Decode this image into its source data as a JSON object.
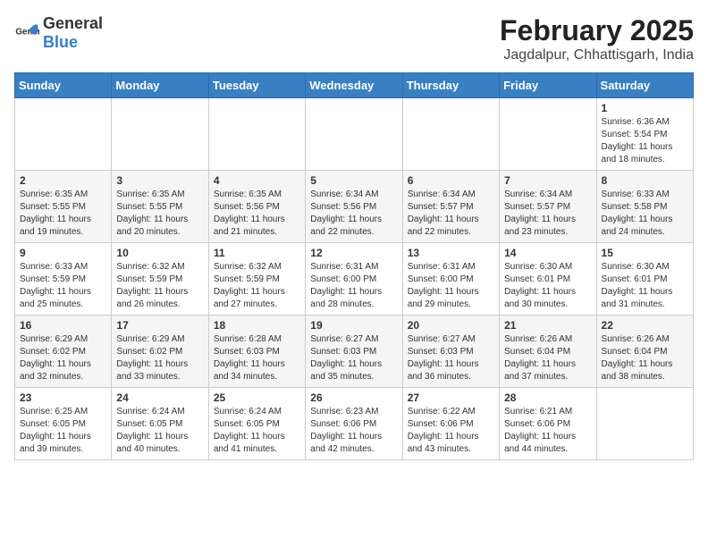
{
  "header": {
    "logo_general": "General",
    "logo_blue": "Blue",
    "month": "February 2025",
    "location": "Jagdalpur, Chhattisgarh, India"
  },
  "weekdays": [
    "Sunday",
    "Monday",
    "Tuesday",
    "Wednesday",
    "Thursday",
    "Friday",
    "Saturday"
  ],
  "weeks": [
    [
      {
        "day": "",
        "info": ""
      },
      {
        "day": "",
        "info": ""
      },
      {
        "day": "",
        "info": ""
      },
      {
        "day": "",
        "info": ""
      },
      {
        "day": "",
        "info": ""
      },
      {
        "day": "",
        "info": ""
      },
      {
        "day": "1",
        "info": "Sunrise: 6:36 AM\nSunset: 5:54 PM\nDaylight: 11 hours\nand 18 minutes."
      }
    ],
    [
      {
        "day": "2",
        "info": "Sunrise: 6:35 AM\nSunset: 5:55 PM\nDaylight: 11 hours\nand 19 minutes."
      },
      {
        "day": "3",
        "info": "Sunrise: 6:35 AM\nSunset: 5:55 PM\nDaylight: 11 hours\nand 20 minutes."
      },
      {
        "day": "4",
        "info": "Sunrise: 6:35 AM\nSunset: 5:56 PM\nDaylight: 11 hours\nand 21 minutes."
      },
      {
        "day": "5",
        "info": "Sunrise: 6:34 AM\nSunset: 5:56 PM\nDaylight: 11 hours\nand 22 minutes."
      },
      {
        "day": "6",
        "info": "Sunrise: 6:34 AM\nSunset: 5:57 PM\nDaylight: 11 hours\nand 22 minutes."
      },
      {
        "day": "7",
        "info": "Sunrise: 6:34 AM\nSunset: 5:57 PM\nDaylight: 11 hours\nand 23 minutes."
      },
      {
        "day": "8",
        "info": "Sunrise: 6:33 AM\nSunset: 5:58 PM\nDaylight: 11 hours\nand 24 minutes."
      }
    ],
    [
      {
        "day": "9",
        "info": "Sunrise: 6:33 AM\nSunset: 5:59 PM\nDaylight: 11 hours\nand 25 minutes."
      },
      {
        "day": "10",
        "info": "Sunrise: 6:32 AM\nSunset: 5:59 PM\nDaylight: 11 hours\nand 26 minutes."
      },
      {
        "day": "11",
        "info": "Sunrise: 6:32 AM\nSunset: 5:59 PM\nDaylight: 11 hours\nand 27 minutes."
      },
      {
        "day": "12",
        "info": "Sunrise: 6:31 AM\nSunset: 6:00 PM\nDaylight: 11 hours\nand 28 minutes."
      },
      {
        "day": "13",
        "info": "Sunrise: 6:31 AM\nSunset: 6:00 PM\nDaylight: 11 hours\nand 29 minutes."
      },
      {
        "day": "14",
        "info": "Sunrise: 6:30 AM\nSunset: 6:01 PM\nDaylight: 11 hours\nand 30 minutes."
      },
      {
        "day": "15",
        "info": "Sunrise: 6:30 AM\nSunset: 6:01 PM\nDaylight: 11 hours\nand 31 minutes."
      }
    ],
    [
      {
        "day": "16",
        "info": "Sunrise: 6:29 AM\nSunset: 6:02 PM\nDaylight: 11 hours\nand 32 minutes."
      },
      {
        "day": "17",
        "info": "Sunrise: 6:29 AM\nSunset: 6:02 PM\nDaylight: 11 hours\nand 33 minutes."
      },
      {
        "day": "18",
        "info": "Sunrise: 6:28 AM\nSunset: 6:03 PM\nDaylight: 11 hours\nand 34 minutes."
      },
      {
        "day": "19",
        "info": "Sunrise: 6:27 AM\nSunset: 6:03 PM\nDaylight: 11 hours\nand 35 minutes."
      },
      {
        "day": "20",
        "info": "Sunrise: 6:27 AM\nSunset: 6:03 PM\nDaylight: 11 hours\nand 36 minutes."
      },
      {
        "day": "21",
        "info": "Sunrise: 6:26 AM\nSunset: 6:04 PM\nDaylight: 11 hours\nand 37 minutes."
      },
      {
        "day": "22",
        "info": "Sunrise: 6:26 AM\nSunset: 6:04 PM\nDaylight: 11 hours\nand 38 minutes."
      }
    ],
    [
      {
        "day": "23",
        "info": "Sunrise: 6:25 AM\nSunset: 6:05 PM\nDaylight: 11 hours\nand 39 minutes."
      },
      {
        "day": "24",
        "info": "Sunrise: 6:24 AM\nSunset: 6:05 PM\nDaylight: 11 hours\nand 40 minutes."
      },
      {
        "day": "25",
        "info": "Sunrise: 6:24 AM\nSunset: 6:05 PM\nDaylight: 11 hours\nand 41 minutes."
      },
      {
        "day": "26",
        "info": "Sunrise: 6:23 AM\nSunset: 6:06 PM\nDaylight: 11 hours\nand 42 minutes."
      },
      {
        "day": "27",
        "info": "Sunrise: 6:22 AM\nSunset: 6:06 PM\nDaylight: 11 hours\nand 43 minutes."
      },
      {
        "day": "28",
        "info": "Sunrise: 6:21 AM\nSunset: 6:06 PM\nDaylight: 11 hours\nand 44 minutes."
      },
      {
        "day": "",
        "info": ""
      }
    ]
  ]
}
